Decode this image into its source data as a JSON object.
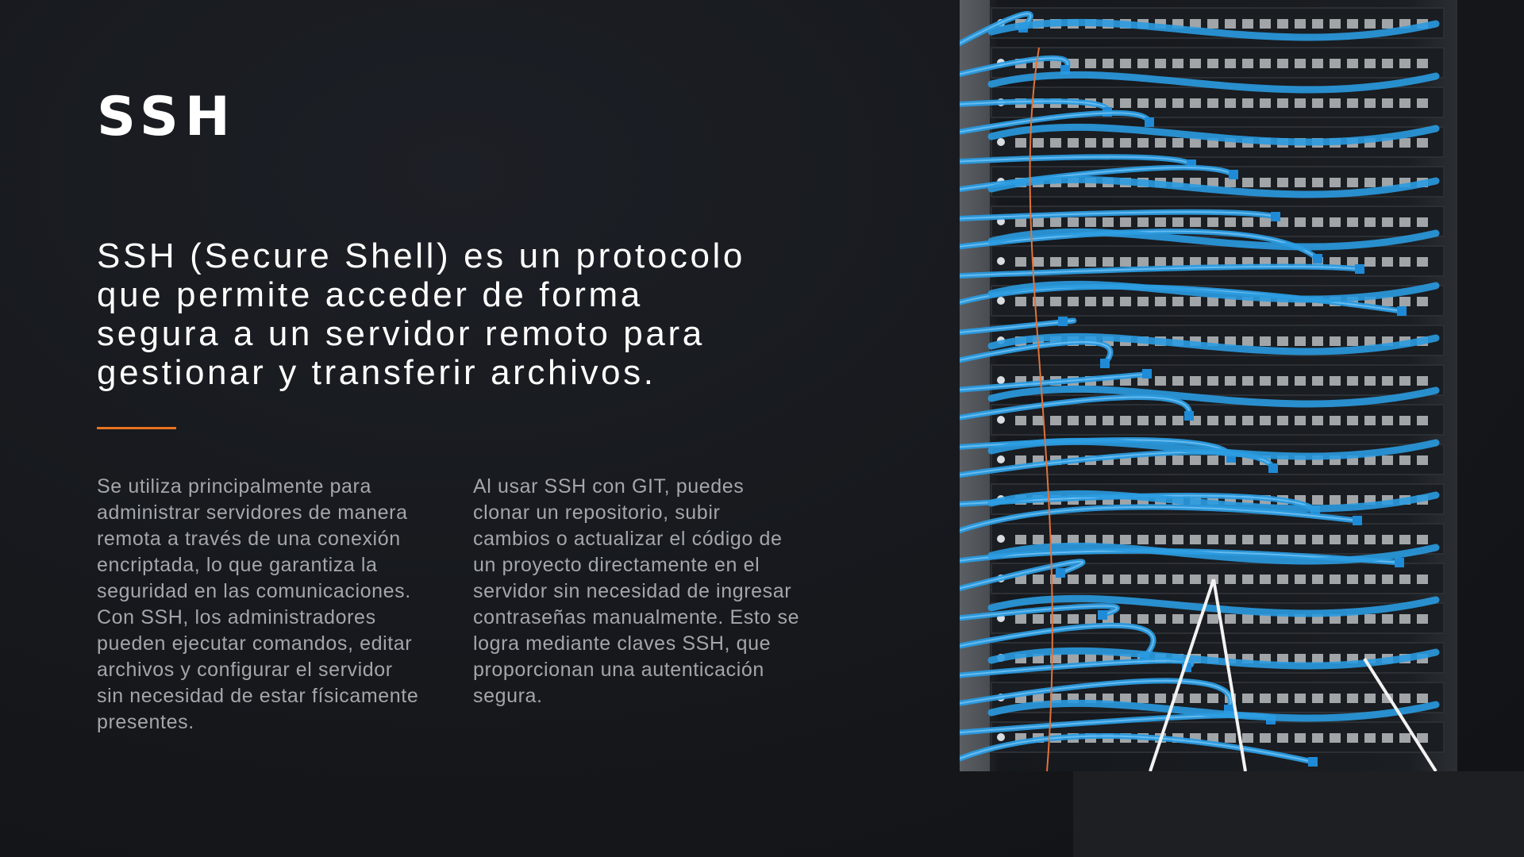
{
  "slide": {
    "title": "SSH",
    "lead": "SSH (Secure Shell) es un protocolo\nque permite acceder de forma\nsegura a un servidor remoto para\ngestionar y transferir archivos.",
    "accent_color": "#e8731d",
    "columns": [
      {
        "text": "Se utiliza principalmente para\nadministrar servidores de manera\nremota a través de una conexión\nencriptada, lo que garantiza la\nseguridad en las comunicaciones.\nCon SSH, los administradores\npueden ejecutar comandos, editar\narchivos y configurar el servidor\nsin necesidad de estar físicamente\npresentes."
      },
      {
        "text": "Al usar SSH con GIT, puedes\nclonar un repositorio, subir\ncambios o actualizar el código de\nun proyecto directamente en el\nservidor sin necesidad de ingresar\ncontraseñas manualmente. Esto se\nlogra mediante claves SSH, que\nproporcionan una autenticación\nsegura."
      }
    ]
  },
  "image": {
    "subject": "server-rack-network-cables-photo",
    "cable_color": "#2a9be0",
    "rack_color": "#1a1d21"
  }
}
